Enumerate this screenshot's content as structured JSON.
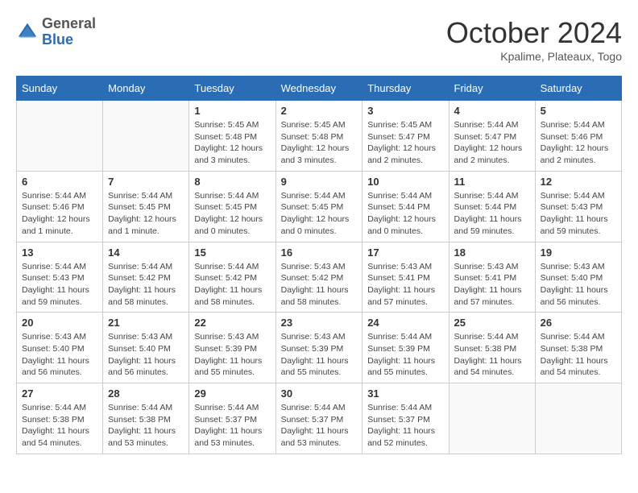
{
  "header": {
    "logo_general": "General",
    "logo_blue": "Blue",
    "month_title": "October 2024",
    "location": "Kpalime, Plateaux, Togo"
  },
  "weekdays": [
    "Sunday",
    "Monday",
    "Tuesday",
    "Wednesday",
    "Thursday",
    "Friday",
    "Saturday"
  ],
  "weeks": [
    [
      {
        "day": "",
        "info": ""
      },
      {
        "day": "",
        "info": ""
      },
      {
        "day": "1",
        "info": "Sunrise: 5:45 AM\nSunset: 5:48 PM\nDaylight: 12 hours and 3 minutes."
      },
      {
        "day": "2",
        "info": "Sunrise: 5:45 AM\nSunset: 5:48 PM\nDaylight: 12 hours and 3 minutes."
      },
      {
        "day": "3",
        "info": "Sunrise: 5:45 AM\nSunset: 5:47 PM\nDaylight: 12 hours and 2 minutes."
      },
      {
        "day": "4",
        "info": "Sunrise: 5:44 AM\nSunset: 5:47 PM\nDaylight: 12 hours and 2 minutes."
      },
      {
        "day": "5",
        "info": "Sunrise: 5:44 AM\nSunset: 5:46 PM\nDaylight: 12 hours and 2 minutes."
      }
    ],
    [
      {
        "day": "6",
        "info": "Sunrise: 5:44 AM\nSunset: 5:46 PM\nDaylight: 12 hours and 1 minute."
      },
      {
        "day": "7",
        "info": "Sunrise: 5:44 AM\nSunset: 5:45 PM\nDaylight: 12 hours and 1 minute."
      },
      {
        "day": "8",
        "info": "Sunrise: 5:44 AM\nSunset: 5:45 PM\nDaylight: 12 hours and 0 minutes."
      },
      {
        "day": "9",
        "info": "Sunrise: 5:44 AM\nSunset: 5:45 PM\nDaylight: 12 hours and 0 minutes."
      },
      {
        "day": "10",
        "info": "Sunrise: 5:44 AM\nSunset: 5:44 PM\nDaylight: 12 hours and 0 minutes."
      },
      {
        "day": "11",
        "info": "Sunrise: 5:44 AM\nSunset: 5:44 PM\nDaylight: 11 hours and 59 minutes."
      },
      {
        "day": "12",
        "info": "Sunrise: 5:44 AM\nSunset: 5:43 PM\nDaylight: 11 hours and 59 minutes."
      }
    ],
    [
      {
        "day": "13",
        "info": "Sunrise: 5:44 AM\nSunset: 5:43 PM\nDaylight: 11 hours and 59 minutes."
      },
      {
        "day": "14",
        "info": "Sunrise: 5:44 AM\nSunset: 5:42 PM\nDaylight: 11 hours and 58 minutes."
      },
      {
        "day": "15",
        "info": "Sunrise: 5:44 AM\nSunset: 5:42 PM\nDaylight: 11 hours and 58 minutes."
      },
      {
        "day": "16",
        "info": "Sunrise: 5:43 AM\nSunset: 5:42 PM\nDaylight: 11 hours and 58 minutes."
      },
      {
        "day": "17",
        "info": "Sunrise: 5:43 AM\nSunset: 5:41 PM\nDaylight: 11 hours and 57 minutes."
      },
      {
        "day": "18",
        "info": "Sunrise: 5:43 AM\nSunset: 5:41 PM\nDaylight: 11 hours and 57 minutes."
      },
      {
        "day": "19",
        "info": "Sunrise: 5:43 AM\nSunset: 5:40 PM\nDaylight: 11 hours and 56 minutes."
      }
    ],
    [
      {
        "day": "20",
        "info": "Sunrise: 5:43 AM\nSunset: 5:40 PM\nDaylight: 11 hours and 56 minutes."
      },
      {
        "day": "21",
        "info": "Sunrise: 5:43 AM\nSunset: 5:40 PM\nDaylight: 11 hours and 56 minutes."
      },
      {
        "day": "22",
        "info": "Sunrise: 5:43 AM\nSunset: 5:39 PM\nDaylight: 11 hours and 55 minutes."
      },
      {
        "day": "23",
        "info": "Sunrise: 5:43 AM\nSunset: 5:39 PM\nDaylight: 11 hours and 55 minutes."
      },
      {
        "day": "24",
        "info": "Sunrise: 5:44 AM\nSunset: 5:39 PM\nDaylight: 11 hours and 55 minutes."
      },
      {
        "day": "25",
        "info": "Sunrise: 5:44 AM\nSunset: 5:38 PM\nDaylight: 11 hours and 54 minutes."
      },
      {
        "day": "26",
        "info": "Sunrise: 5:44 AM\nSunset: 5:38 PM\nDaylight: 11 hours and 54 minutes."
      }
    ],
    [
      {
        "day": "27",
        "info": "Sunrise: 5:44 AM\nSunset: 5:38 PM\nDaylight: 11 hours and 54 minutes."
      },
      {
        "day": "28",
        "info": "Sunrise: 5:44 AM\nSunset: 5:38 PM\nDaylight: 11 hours and 53 minutes."
      },
      {
        "day": "29",
        "info": "Sunrise: 5:44 AM\nSunset: 5:37 PM\nDaylight: 11 hours and 53 minutes."
      },
      {
        "day": "30",
        "info": "Sunrise: 5:44 AM\nSunset: 5:37 PM\nDaylight: 11 hours and 53 minutes."
      },
      {
        "day": "31",
        "info": "Sunrise: 5:44 AM\nSunset: 5:37 PM\nDaylight: 11 hours and 52 minutes."
      },
      {
        "day": "",
        "info": ""
      },
      {
        "day": "",
        "info": ""
      }
    ]
  ]
}
